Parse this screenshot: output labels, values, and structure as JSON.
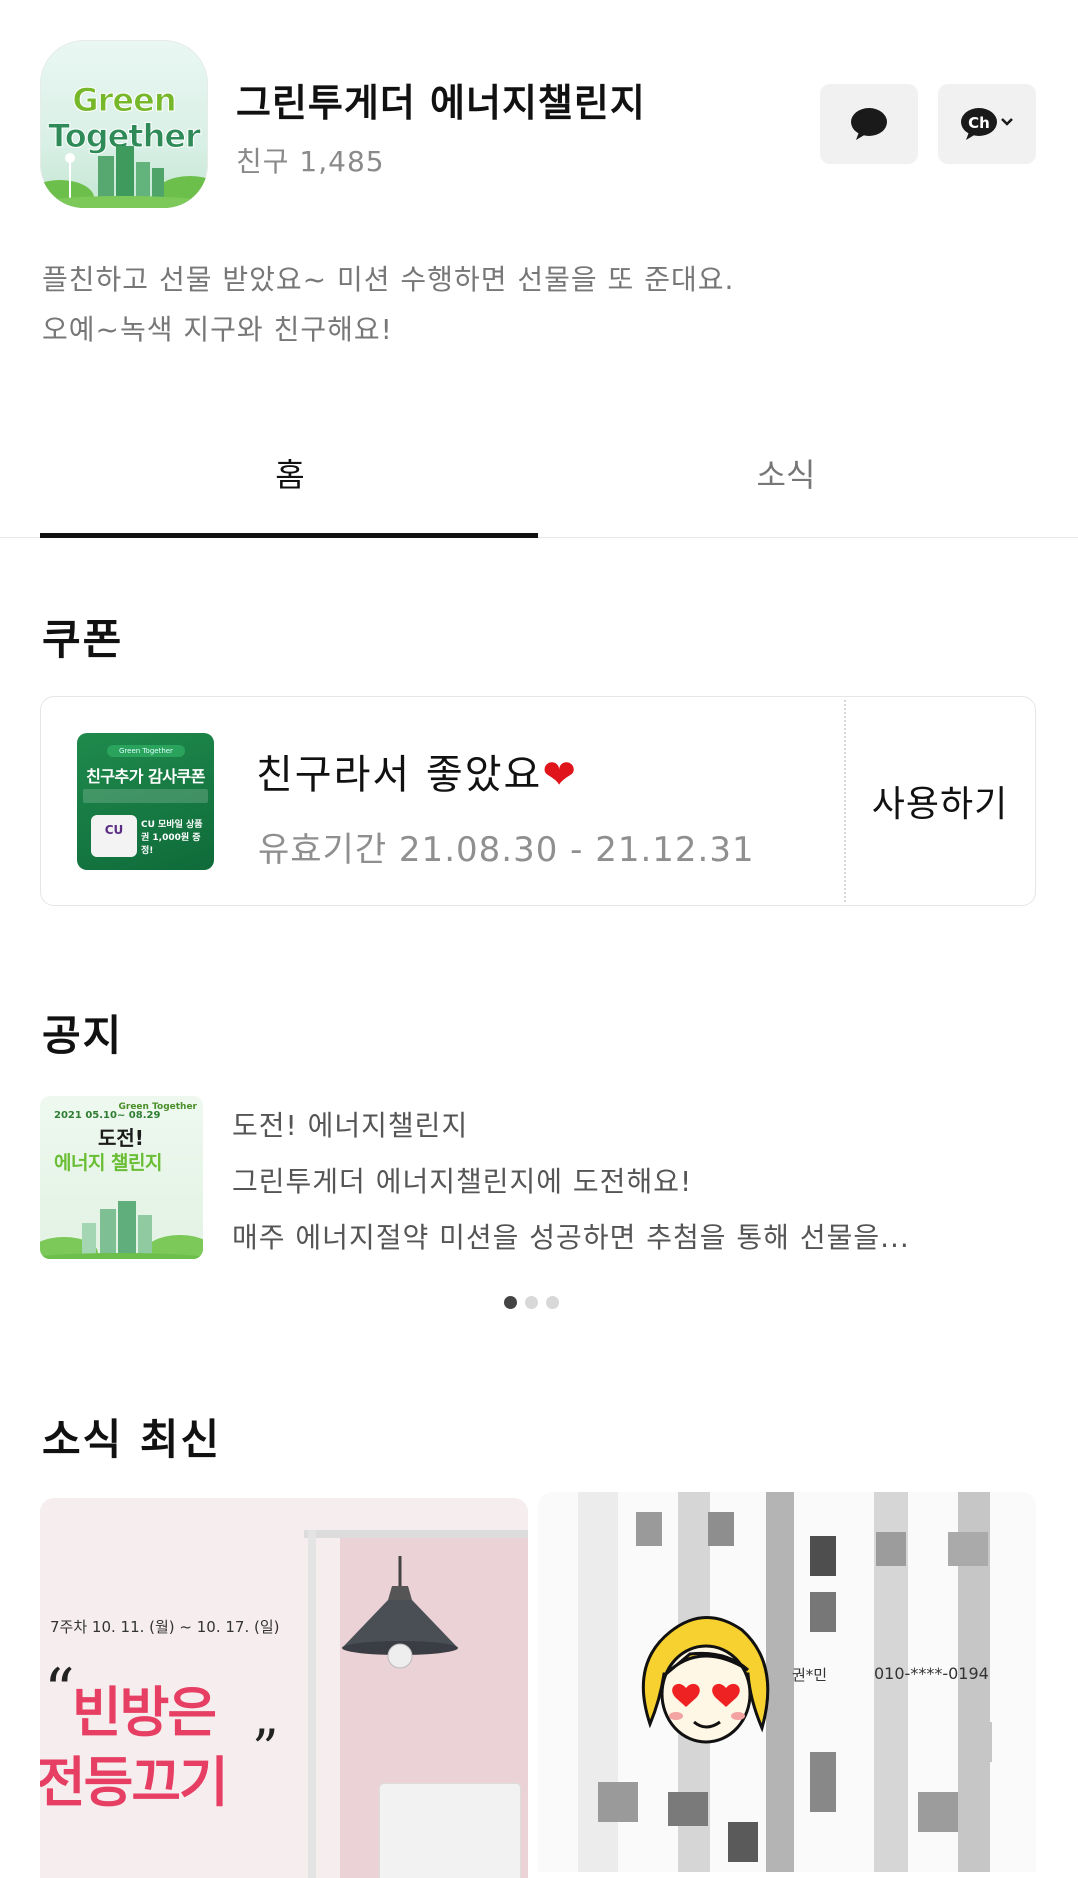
{
  "channel": {
    "name": "그린투게더 에너지챌린지",
    "friends": "친구 1,485",
    "logo_lines": [
      "Green",
      "Together"
    ],
    "description": [
      "플친하고 선물 받았요~ 미션 수행하면 선물을 또 준대요.",
      "오예~녹색 지구와 친구해요!"
    ]
  },
  "header_buttons": {
    "chat_icon": "speech-bubble-icon",
    "channel_label": "Ch"
  },
  "tabs": [
    {
      "label": "홈",
      "active": true
    },
    {
      "label": "소식",
      "active": false
    }
  ],
  "coupon_section": {
    "title": "쿠폰",
    "coupon": {
      "thumb_title": "친구추가 감사쿠폰",
      "thumb_brand": "CU",
      "thumb_gift": "CU 모바일 상품권 1,000원 증정!",
      "title": "친구라서 좋았요",
      "heart": "❤",
      "validity": "유효기간 21.08.30 - 21.12.31",
      "action": "사용하기"
    }
  },
  "notice_section": {
    "title": "공지",
    "thumb": {
      "date": "2021 05.10~ 08.29",
      "title1": "도전!",
      "title2": "에너지 챌린지",
      "brand": "Green Together"
    },
    "lines": [
      "도전! 에너지챌린지",
      "그린투게더 에너지챌린지에 도전해요!",
      "매주 에너지절약 미션을 성공하면 추첨을 통해 선물을..."
    ],
    "page_count": 3,
    "active_page": 1
  },
  "news_section": {
    "title": "소식 최신",
    "card1": {
      "week": "7주차 10. 11. (월) ~ 10. 17. (일)",
      "quote_open": "“",
      "quote_close": "”",
      "headline1": "빈방은",
      "headline2": "전등끄기"
    },
    "card2": {
      "name": "권*민",
      "phone": "010-****-0194"
    }
  },
  "colors": {
    "accent_red": "#e63f63",
    "heart": "#e0151b",
    "green": "#1f8a4c"
  }
}
